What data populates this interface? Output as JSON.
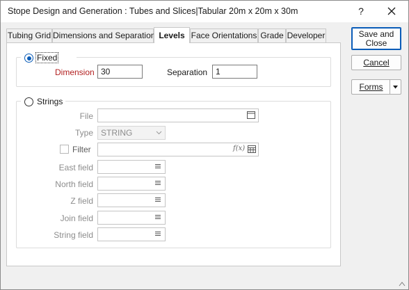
{
  "window": {
    "title": "Stope Design and Generation : Tubes and Slices|Tabular 20m x 20m x 30m",
    "help_glyph": "?",
    "close_icon": "close-icon"
  },
  "tabs": [
    {
      "label": "Tubing Grid",
      "active": false
    },
    {
      "label": "Dimensions and Separations",
      "active": false
    },
    {
      "label": "Levels",
      "active": true
    },
    {
      "label": "Face Orientations",
      "active": false
    },
    {
      "label": "Grade",
      "active": false
    },
    {
      "label": "Developer",
      "active": false
    }
  ],
  "fixed_group": {
    "radio_label": "Fixed",
    "selected": true,
    "dimension_label": "Dimension",
    "dimension_value": "30",
    "separation_label": "Separation",
    "separation_value": "1"
  },
  "strings_group": {
    "radio_label": "Strings",
    "selected": false,
    "file_label": "File",
    "file_value": "",
    "type_label": "Type",
    "type_value": "STRING",
    "filter_label": "Filter",
    "filter_checked": false,
    "filter_value": "",
    "filter_icon_text": "f(x)",
    "east_field_label": "East field",
    "north_field_label": "North field",
    "z_field_label": "Z field",
    "join_field_label": "Join field",
    "string_field_label": "String field"
  },
  "buttons": {
    "save_close": "Save and Close",
    "cancel": "Cancel",
    "forms": "Forms",
    "forms_dropdown_icon": "triangle-down-icon"
  },
  "colors": {
    "accent": "#0a5cb8",
    "required_label": "#b22020",
    "disabled_text": "#8d8d8d"
  }
}
